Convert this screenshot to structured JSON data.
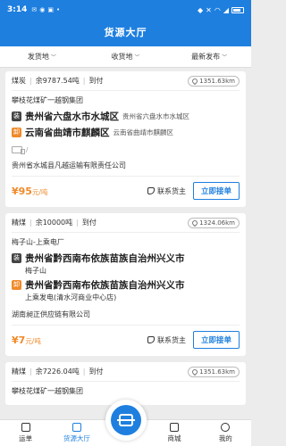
{
  "status": {
    "time": "3:14"
  },
  "header": {
    "title": "货源大厅"
  },
  "filters": [
    {
      "label": "发货地"
    },
    {
      "label": "收货地"
    },
    {
      "label": "最新发布"
    }
  ],
  "cards": [
    {
      "cargo": "煤炭",
      "amount": "余9787.54吨",
      "pay": "到付",
      "distance": "1351.63km",
      "origin_company": "攀枝花煤矿一越钢集团",
      "load_main": "贵州省六盘水市水城区",
      "load_sub": "贵州省六盘水市水城区",
      "unload_main": "云南省曲靖市麒麟区",
      "unload_sub": "云南省曲靖市麒麟区",
      "truck_info": "/",
      "shipper": "贵州省水城县凡越运输有限责任公司",
      "price": "¥95",
      "price_unit": "元/吨",
      "contact": "联系货主",
      "grab": "立即接单"
    },
    {
      "cargo": "精煤",
      "amount": "余10000吨",
      "pay": "到付",
      "distance": "1324.06km",
      "origin_company": "梅子山-上乘电厂",
      "load_main": "贵州省黔西南布依族苗族自治州兴义市",
      "load_sub_line": "梅子山",
      "unload_main": "贵州省黔西南布依族苗族自治州兴义市",
      "unload_sub_line": "上乘发电(清水河商业中心店)",
      "shipper": "湖南昶正供应链有限公司",
      "price": "¥7",
      "price_unit": "元/吨",
      "contact": "联系货主",
      "grab": "立即接单"
    },
    {
      "cargo": "精煤",
      "amount": "余7226.04吨",
      "pay": "到付",
      "distance": "1351.63km",
      "origin_company": "攀枝花煤矿一越钢集团"
    }
  ],
  "tabbar": [
    {
      "label": "运单"
    },
    {
      "label": "货源大厅"
    },
    {
      "label": "商城"
    },
    {
      "label": "我的"
    }
  ]
}
